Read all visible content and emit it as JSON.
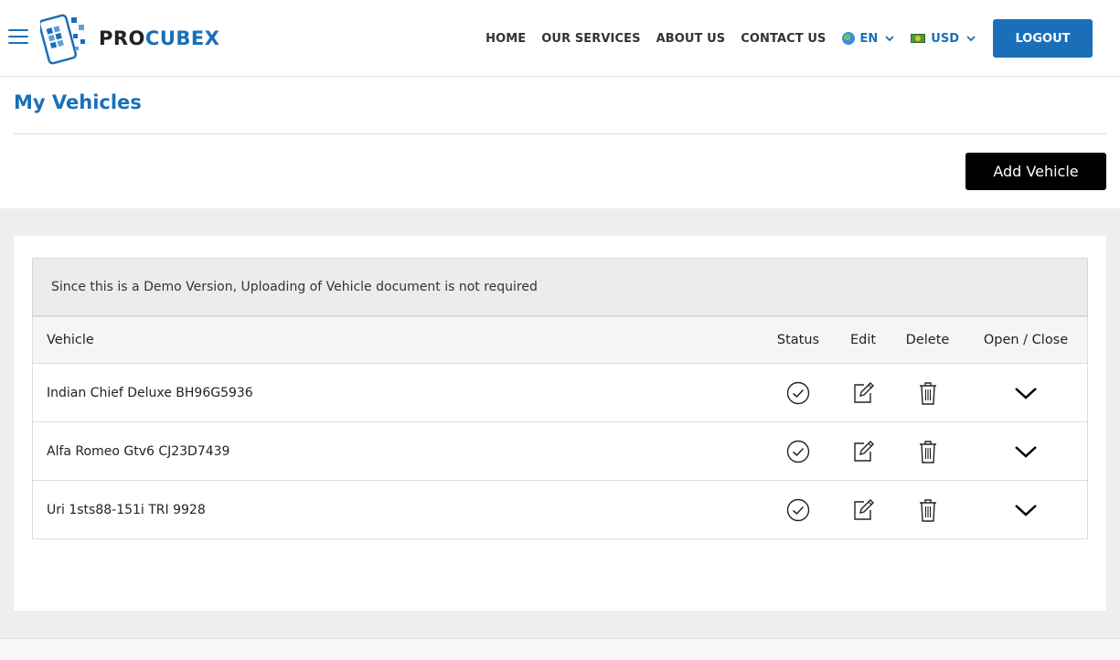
{
  "brand": {
    "name_part1": "PRO",
    "name_part2": "CUBEX"
  },
  "nav": {
    "links": [
      "HOME",
      "OUR SERVICES",
      "ABOUT US",
      "CONTACT US"
    ],
    "language": "EN",
    "currency": "USD",
    "logout_label": "LOGOUT"
  },
  "page": {
    "title": "My Vehicles",
    "add_button_label": "Add Vehicle",
    "notice": "Since this is a Demo Version, Uploading of Vehicle document is not required"
  },
  "table": {
    "columns": [
      "Vehicle",
      "Status",
      "Edit",
      "Delete",
      "Open / Close"
    ],
    "rows": [
      {
        "vehicle": "Indian Chief Deluxe BH96G5936"
      },
      {
        "vehicle": "Alfa Romeo Gtv6 CJ23D7439"
      },
      {
        "vehicle": "Uri 1sts88-151i TRI 9928"
      }
    ]
  },
  "colors": {
    "accent": "#1a6fb8",
    "dark_button": "#000000",
    "band": "#eeeeee"
  },
  "icons": [
    "menu-icon",
    "globe-flag-icon",
    "money-flag-icon",
    "chevron-down-icon",
    "check-circle-icon",
    "edit-icon",
    "trash-icon"
  ]
}
